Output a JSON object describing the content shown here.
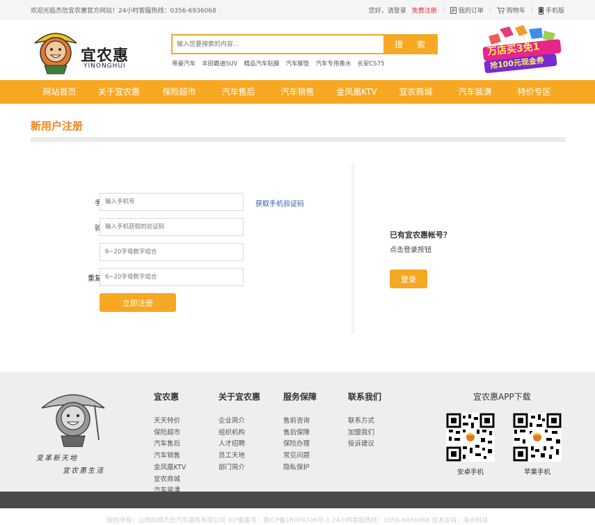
{
  "topbar": {
    "welcome": "欢迎光临杰信宜农惠官方网站！24小时客服热线：0356-6936068",
    "greeting": "您好，请登录",
    "register": "免费注册",
    "orders": "我的订单",
    "cart": "购物车",
    "mobile": "手机版"
  },
  "header": {
    "logo_cn": "宜农惠",
    "logo_en": "YINONGHUI",
    "search_placeholder": "输入您要搜索的内容...",
    "search_button": "搜 索",
    "hot_keywords": [
      "帝豪汽车",
      "丰田霸道SUV",
      "精品汽车贴膜",
      "汽车脚垫",
      "汽车专用香水",
      "长安CS75"
    ],
    "banner_line1": "万店买3免1",
    "banner_line2": "抢100元现金券"
  },
  "nav": [
    "网站首页",
    "关于宜农惠",
    "保险超市",
    "汽车售后",
    "汽车销售",
    "金凤凰KTV",
    "宜农商城",
    "汽车装潢",
    "特价专区"
  ],
  "page": {
    "title": "新用户注册"
  },
  "form": {
    "phone_label": "手机号",
    "phone_placeholder": "输入手机号",
    "get_code": "获取手机验证码",
    "code_label": "验证码",
    "code_placeholder": "输入手机获取的验证码",
    "pwd_label": "密码",
    "pwd_placeholder": "6~20字母数字组合",
    "repwd_label": "重复密码",
    "repwd_placeholder": "6~20字母数字组合",
    "submit": "立即注册",
    "required_mark": "*"
  },
  "login": {
    "question": "已有宜农惠帐号？",
    "hint": "点击登录按钮",
    "button": "登录"
  },
  "footer": {
    "slogan1": "变革新天地",
    "slogan2": "宜农惠生活",
    "columns": [
      {
        "title": "宜农惠",
        "links": [
          "天天特价",
          "保险超市",
          "汽车售后",
          "汽车销售",
          "金凤凰KTV",
          "宜农商城",
          "汽车装潢"
        ]
      },
      {
        "title": "关于宜农惠",
        "links": [
          "企业简介",
          "组织机构",
          "人才招聘",
          "员工天地",
          "部门简介"
        ]
      },
      {
        "title": "服务保障",
        "links": [
          "售前咨询",
          "售后保障",
          "保险办理",
          "常见问题",
          "隐私保护"
        ]
      },
      {
        "title": "联系我们",
        "links": [
          "联系方式",
          "加盟我们",
          "投诉建议"
        ]
      }
    ],
    "app_title": "宜农惠APP下载",
    "android": "安卓手机",
    "ios": "苹果手机",
    "copyright": "版权所有：山西阳城杰信汽车服务有限公司    ICP备案号：晋ICP备16009706号-1    24小时客服热线：0356-6936068    技术支持：海点科技"
  },
  "colors": {
    "accent": "#f7a823",
    "title": "#f08519",
    "red": "#e02c2c",
    "link": "#2a5caa"
  }
}
